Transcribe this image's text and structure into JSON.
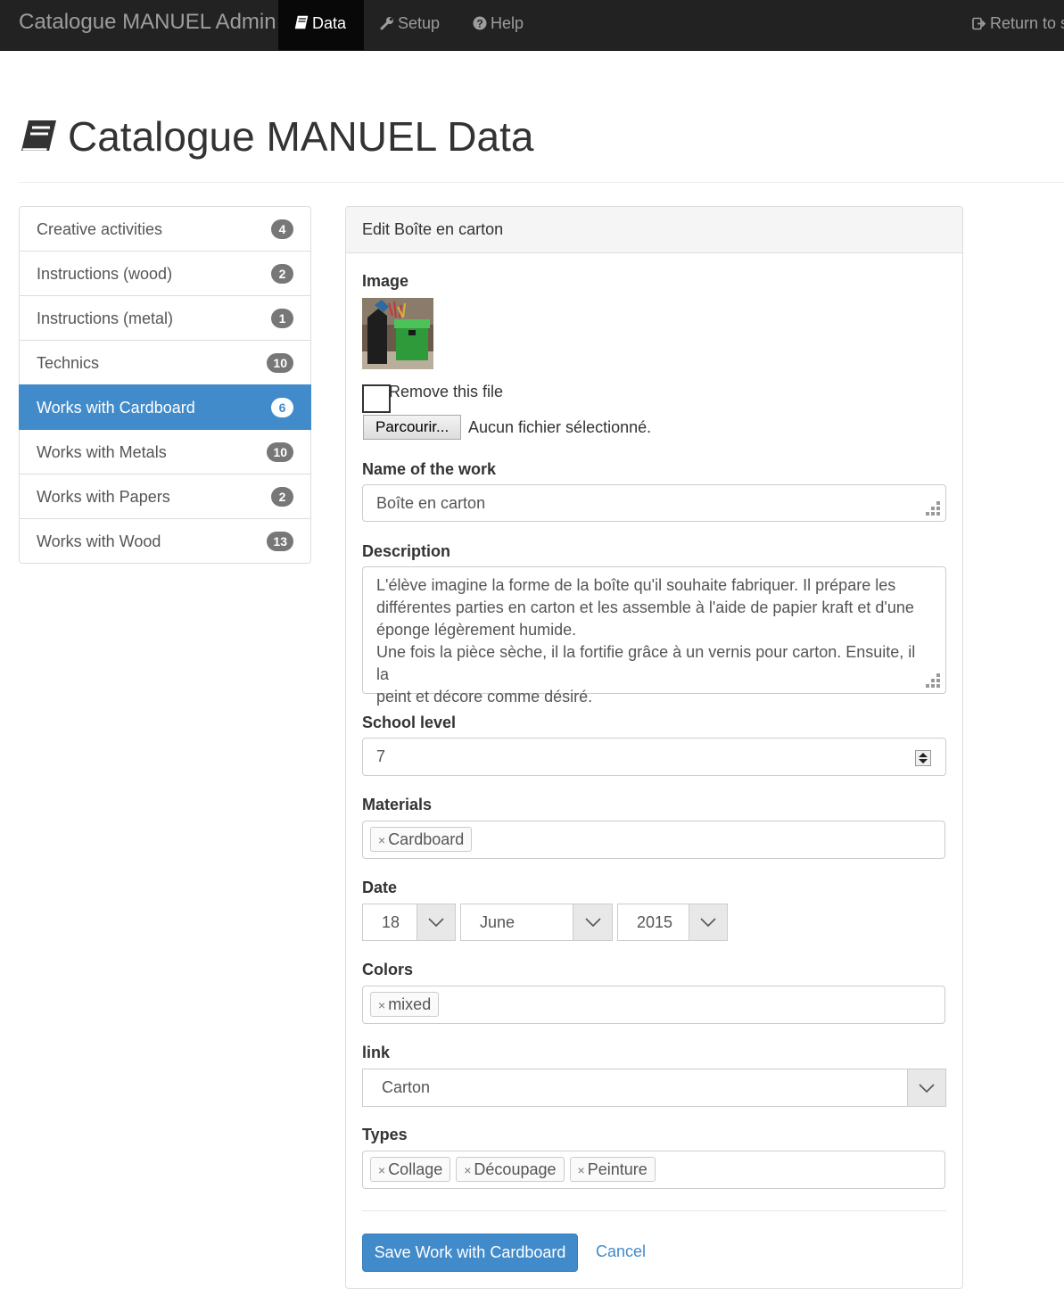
{
  "navbar": {
    "brand": "Catalogue MANUEL Admin",
    "items": [
      {
        "label": "Data",
        "icon": "book-icon",
        "active": true
      },
      {
        "label": "Setup",
        "icon": "wrench-icon"
      },
      {
        "label": "Help",
        "icon": "question-circle-icon"
      }
    ],
    "return_label": "Return to s"
  },
  "page": {
    "title": "Catalogue MANUEL Data"
  },
  "sidebar": {
    "items": [
      {
        "label": "Creative activities",
        "count": "4"
      },
      {
        "label": "Instructions (wood)",
        "count": "2"
      },
      {
        "label": "Instructions (metal)",
        "count": "1"
      },
      {
        "label": "Technics",
        "count": "10"
      },
      {
        "label": "Works with Cardboard",
        "count": "6",
        "active": true
      },
      {
        "label": "Works with Metals",
        "count": "10"
      },
      {
        "label": "Works with Papers",
        "count": "2"
      },
      {
        "label": "Works with Wood",
        "count": "13"
      }
    ],
    "active_color": "#428bca"
  },
  "form": {
    "heading": "Edit Boîte en carton",
    "image_label": "Image",
    "remove_file_label": "Remove this file",
    "browse_button": "Parcourir...",
    "no_file_text": "Aucun fichier sélectionné.",
    "name_label": "Name of the work",
    "name_value": "Boîte en carton",
    "description_label": "Description",
    "description_lines": [
      "L'élève imagine la forme de la boîte qu'il souhaite fabriquer. Il prépare les",
      "différentes parties en carton et les assemble à l'aide de papier kraft et d'une",
      "éponge légèrement humide.",
      "Une fois la pièce sèche, il la fortifie grâce à un vernis pour carton. Ensuite, il la",
      "peint et décore comme désiré."
    ],
    "school_level_label": "School level",
    "school_level_value": "7",
    "materials_label": "Materials",
    "materials": [
      "Cardboard"
    ],
    "date_label": "Date",
    "date_day": "18",
    "date_month": "June",
    "date_year": "2015",
    "colors_label": "Colors",
    "colors": [
      "mixed"
    ],
    "link_label": "link",
    "link_value": "Carton",
    "types_label": "Types",
    "types": [
      "Collage",
      "Découpage",
      "Peinture"
    ],
    "tag_remove_symbol": "×",
    "save_button": "Save Work with Cardboard",
    "cancel_link": "Cancel"
  }
}
